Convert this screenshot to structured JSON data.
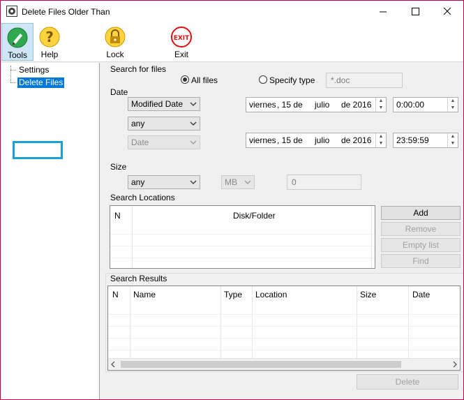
{
  "window": {
    "title": "Delete Files Older Than"
  },
  "toolbar": {
    "tools": "Tools",
    "help": "Help",
    "lock": "Lock",
    "exit": "Exit",
    "exit_icon_text": "EXIT"
  },
  "tree": {
    "items": [
      "Settings",
      "Delete Files"
    ]
  },
  "search_for_files": {
    "label": "Search for files",
    "all_files": "All files",
    "specify_type": "Specify type",
    "type_value": "*.doc"
  },
  "date": {
    "label": "Date",
    "mode": "Modified Date",
    "range": "any",
    "unit": "Date",
    "from": {
      "weekday": "viernes",
      "day": ", 15 de",
      "month": "julio",
      "year": "de 2016",
      "time": "0:00:00"
    },
    "to": {
      "weekday": "viernes",
      "day": ", 15 de",
      "month": "julio",
      "year": "de 2016",
      "time": "23:59:59"
    }
  },
  "size": {
    "label": "Size",
    "range": "any",
    "unit": "MB",
    "value": "0"
  },
  "search_locations": {
    "label": "Search Locations",
    "columns": [
      "N",
      "Disk/Folder"
    ],
    "buttons": {
      "add": "Add",
      "remove": "Remove",
      "empty": "Empty list",
      "find": "Find"
    }
  },
  "search_results": {
    "label": "Search Results",
    "columns": [
      "N",
      "Name",
      "Type",
      "Location",
      "Size",
      "Date"
    ],
    "delete": "Delete"
  },
  "colors": {
    "accent": "#c0004e",
    "selection": "#0078d7",
    "highlight_box": "#1aa0d6"
  }
}
